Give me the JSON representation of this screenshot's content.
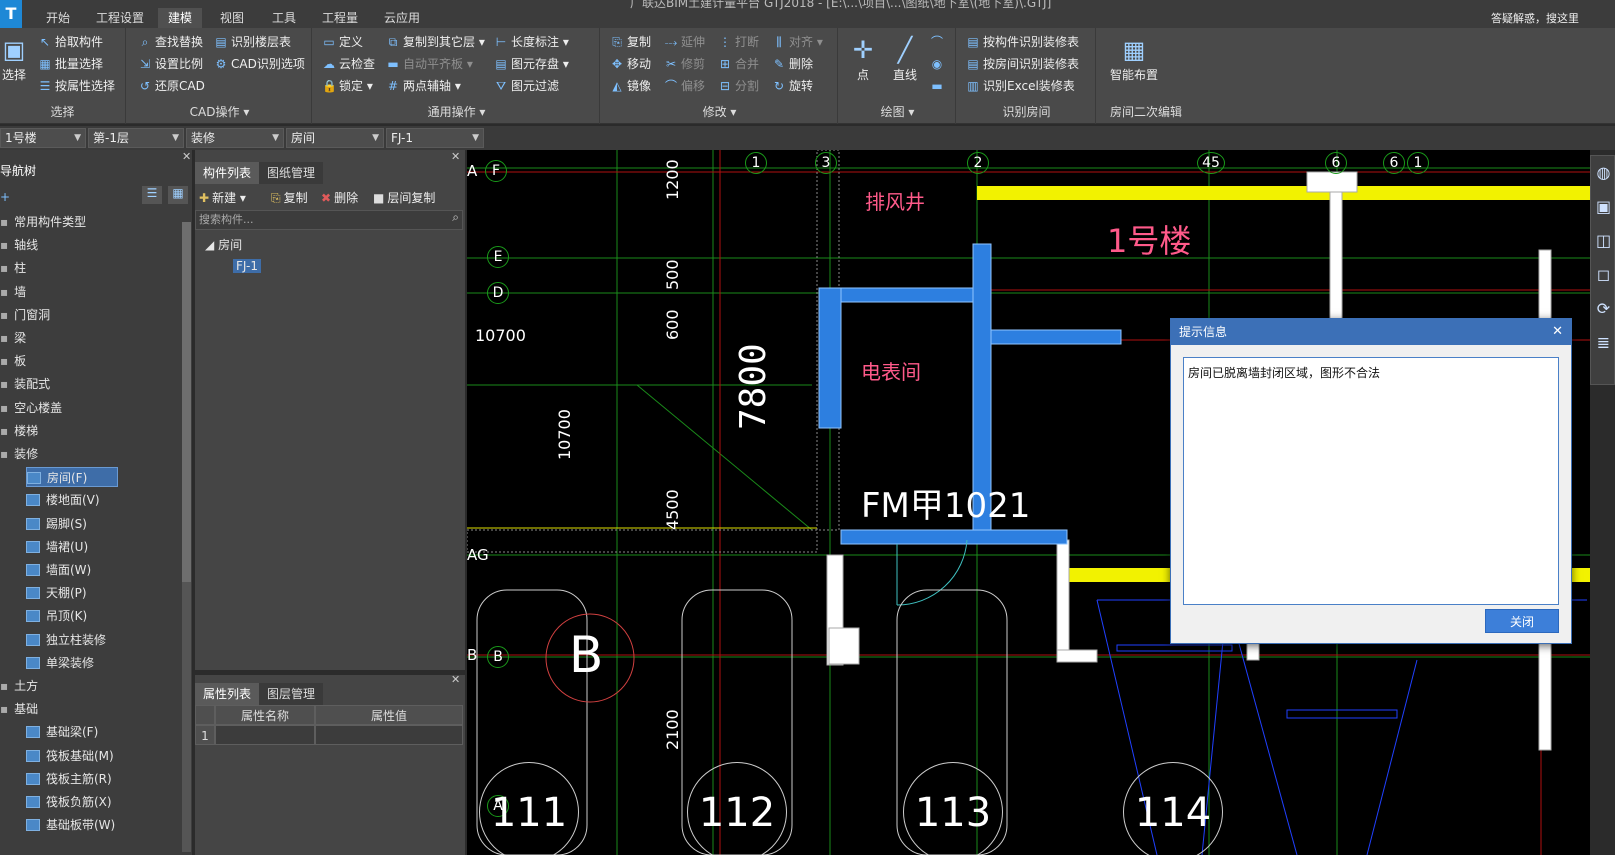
{
  "window_title": "广联达BIM土建计量平台 GTJ2018 - [E:\\...\\项目\\...\\图纸\\地下室\\(地下室)\\.GTJ]",
  "menu": {
    "tabs": [
      "开始",
      "工程设置",
      "建模",
      "视图",
      "工具",
      "工程量",
      "云应用"
    ],
    "help_search": "答疑解惑，搜这里"
  },
  "ribbon": {
    "select_group": {
      "big": "选择",
      "items": [
        "拾取构件",
        "批量选择",
        "按属性选择"
      ],
      "label": "选择"
    },
    "cad_group": {
      "col1": [
        "查找替换",
        "设置比例",
        "还原CAD"
      ],
      "col2": [
        "识别楼层表",
        "CAD识别选项"
      ],
      "label": "CAD操作"
    },
    "common_group": {
      "col1": [
        "定义",
        "云检查",
        "锁定"
      ],
      "col2": [
        "复制到其它层",
        "自动平齐板",
        "两点辅轴"
      ],
      "col3": [
        "长度标注",
        "图元存盘",
        "图元过滤"
      ],
      "label": "通用操作"
    },
    "modify_group": {
      "col1": [
        "复制",
        "移动",
        "镜像"
      ],
      "col2": [
        "延伸",
        "修剪",
        "偏移"
      ],
      "col3": [
        "打断",
        "合并",
        "分割"
      ],
      "col4": [
        "对齐",
        "删除",
        "旋转"
      ],
      "label": "修改"
    },
    "draw_group": {
      "items": [
        "点",
        "直线"
      ],
      "label": "绘图"
    },
    "recognize_group": {
      "items": [
        "按构件识别装修表",
        "按房间识别装修表",
        "识别Excel装修表"
      ],
      "label": "识别房间"
    },
    "edit2_group": {
      "big": "智能布置",
      "label": "房间二次编辑"
    }
  },
  "selectors": [
    "1号楼",
    "第-1层",
    "装修",
    "房间",
    "FJ-1"
  ],
  "nav": {
    "title": "导航树",
    "items": [
      {
        "label": "常用构件类型",
        "level": 0
      },
      {
        "label": "轴线",
        "level": 0
      },
      {
        "label": "柱",
        "level": 0
      },
      {
        "label": "墙",
        "level": 0
      },
      {
        "label": "门窗洞",
        "level": 0
      },
      {
        "label": "梁",
        "level": 0
      },
      {
        "label": "板",
        "level": 0
      },
      {
        "label": "装配式",
        "level": 0
      },
      {
        "label": "空心楼盖",
        "level": 0
      },
      {
        "label": "楼梯",
        "level": 0
      },
      {
        "label": "装修",
        "level": 0
      },
      {
        "label": "房间(F)",
        "level": 1,
        "selected": true
      },
      {
        "label": "楼地面(V)",
        "level": 1
      },
      {
        "label": "踢脚(S)",
        "level": 1
      },
      {
        "label": "墙裙(U)",
        "level": 1
      },
      {
        "label": "墙面(W)",
        "level": 1
      },
      {
        "label": "天棚(P)",
        "level": 1
      },
      {
        "label": "吊顶(K)",
        "level": 1
      },
      {
        "label": "独立柱装修",
        "level": 1
      },
      {
        "label": "单梁装修",
        "level": 1
      },
      {
        "label": "土方",
        "level": 0
      },
      {
        "label": "基础",
        "level": 0
      },
      {
        "label": "基础梁(F)",
        "level": 1
      },
      {
        "label": "筏板基础(M)",
        "level": 1
      },
      {
        "label": "筏板主筋(R)",
        "level": 1
      },
      {
        "label": "筏板负筋(X)",
        "level": 1
      },
      {
        "label": "基础板带(W)",
        "level": 1
      }
    ]
  },
  "components": {
    "tabs": [
      "构件列表",
      "图纸管理"
    ],
    "toolbar": [
      "新建",
      "复制",
      "删除",
      "层间复制"
    ],
    "search_placeholder": "搜索构件...",
    "tree_root": "房间",
    "tree_leaf": "FJ-1"
  },
  "properties": {
    "tabs": [
      "属性列表",
      "图层管理"
    ],
    "headers": [
      "属性名称",
      "属性值"
    ],
    "row_num": "1"
  },
  "canvas": {
    "axis_labels": [
      "1",
      "3",
      "2",
      "45",
      "6",
      "6",
      "1",
      "A",
      "F",
      "E",
      "D",
      "AG",
      "B",
      "B",
      "A"
    ],
    "dims": [
      "1200",
      "500",
      "600",
      "4500",
      "10700",
      "10700",
      "7800",
      "2100"
    ],
    "texts": [
      "排风井",
      "1号楼",
      "电表间",
      "FM甲1021",
      "B"
    ],
    "parking": [
      "111",
      "112",
      "113",
      "114"
    ]
  },
  "dialog": {
    "title": "提示信息",
    "message": "房间已脱离墙封闭区域，图形不合法",
    "ok": "关闭"
  }
}
